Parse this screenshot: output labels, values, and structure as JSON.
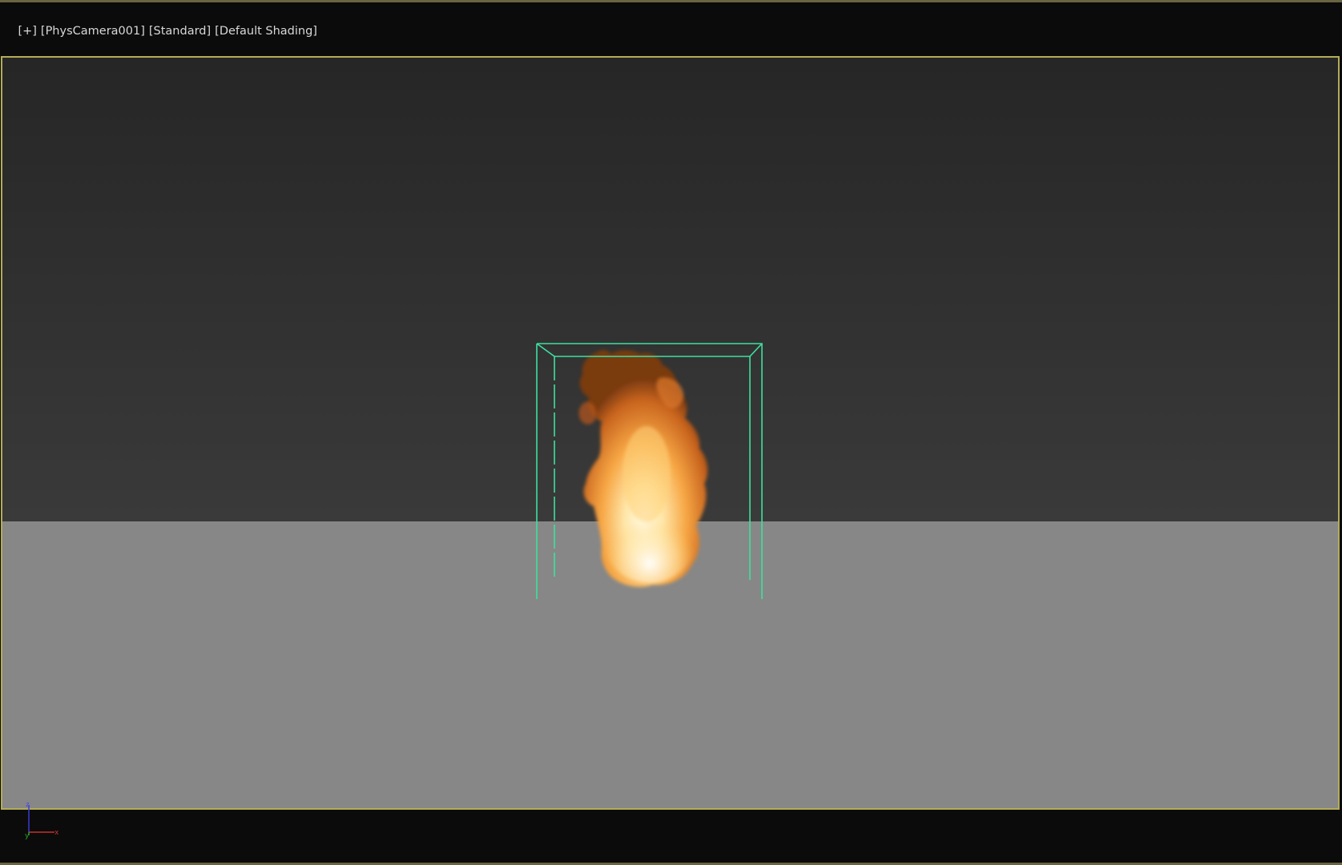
{
  "viewport": {
    "labels": {
      "plus": "[+]",
      "camera": "[PhysCamera001]",
      "mode": "[Standard]",
      "shading": "[Default Shading]"
    },
    "axis": {
      "z": "z",
      "y": "y",
      "x": "x"
    },
    "colors": {
      "border_active": "#b3ac58",
      "selection_box": "#3ee0a0",
      "ground": "#878787",
      "background": "#0b0b0b"
    },
    "icons": {
      "axis": "axis-tripod-icon",
      "fire": "fire-simulation-icon"
    }
  }
}
